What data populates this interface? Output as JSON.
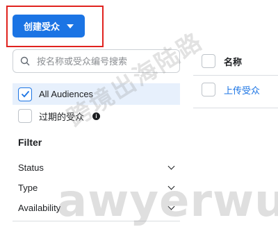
{
  "toolbar": {
    "create_label": "创建受众"
  },
  "search": {
    "placeholder": "按名称或受众编号搜索"
  },
  "filters": {
    "all_label": "All Audiences",
    "expired_label": "过期的受众",
    "heading": "Filter",
    "sections": [
      "Status",
      "Type",
      "Availability"
    ]
  },
  "table": {
    "header": "名称",
    "rows": [
      {
        "name": "上传受众"
      }
    ]
  },
  "watermark": {
    "cn": "跨境出海陆路",
    "en": "awyerwu.com"
  },
  "colors": {
    "accent": "#1b74e4",
    "highlight": "#e0221e"
  }
}
